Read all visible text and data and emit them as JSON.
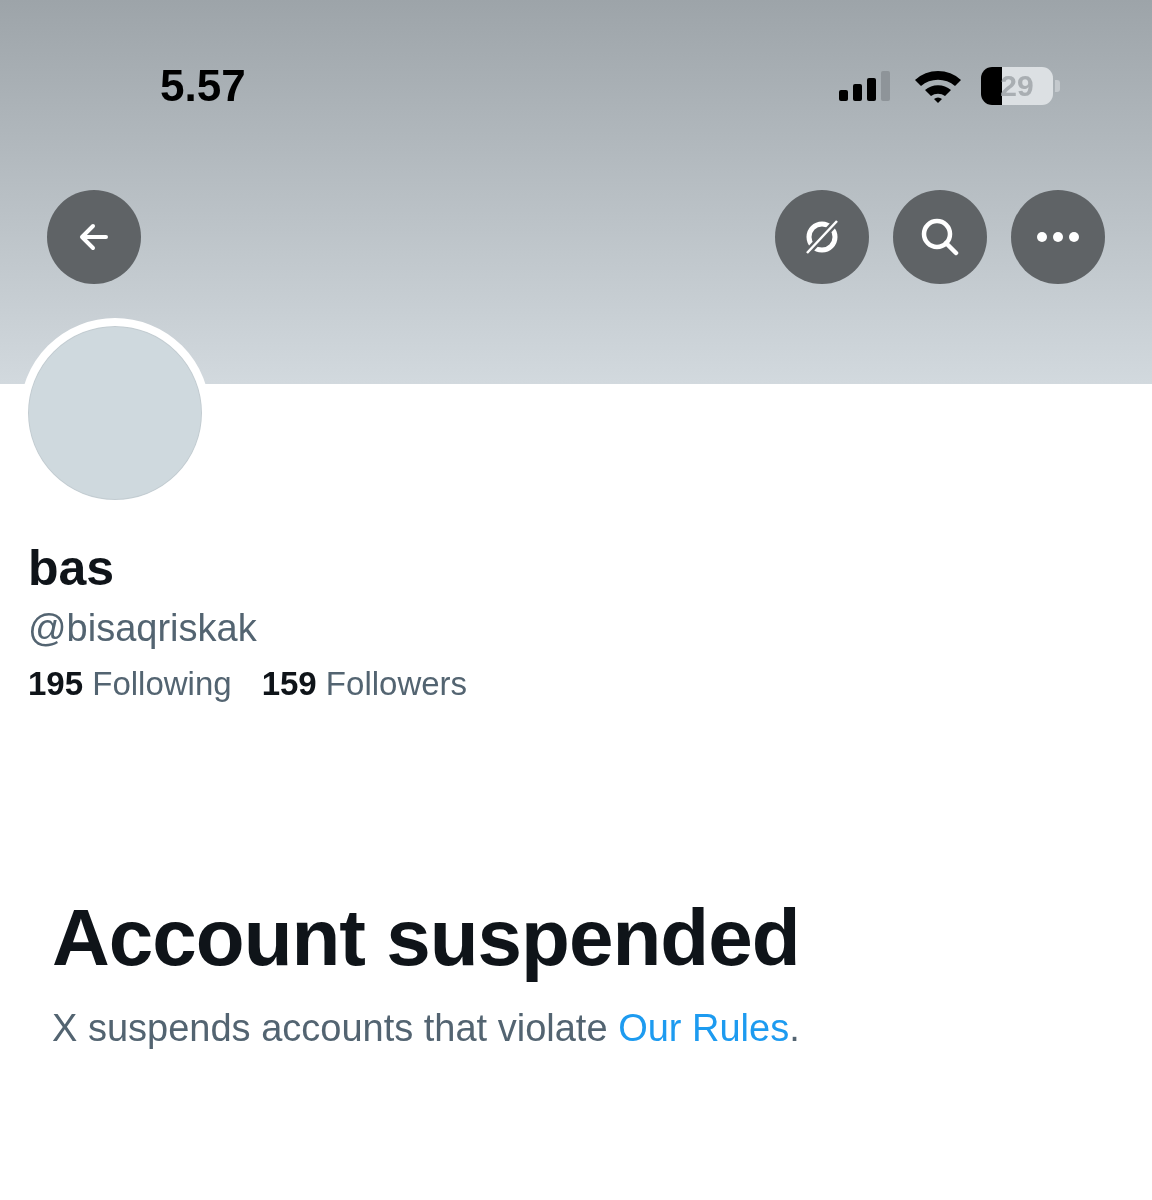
{
  "status_bar": {
    "time": "5.57",
    "battery": {
      "text": "29",
      "level": 0.29
    }
  },
  "header_buttons": [
    {
      "kind": "back"
    },
    {
      "kind": "grok"
    },
    {
      "kind": "search"
    },
    {
      "kind": "more"
    }
  ],
  "profile": {
    "name": "bas",
    "handle": "@bisaqriskak",
    "stats": [
      {
        "count": "195",
        "label": "Following"
      },
      {
        "count": "159",
        "label": "Followers"
      }
    ]
  },
  "notice": {
    "title": "Account suspended",
    "message": "X suspends accounts that violate ",
    "link": "Our Rules",
    "tail": "."
  }
}
